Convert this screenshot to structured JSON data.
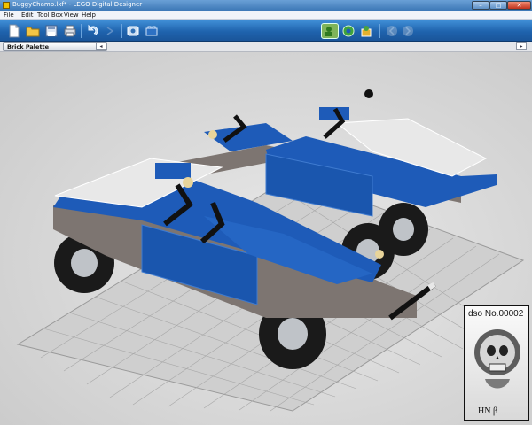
{
  "window": {
    "title": "BuggyChamp.lxf* - LEGO Digital Designer"
  },
  "menu": {
    "items": [
      "File",
      "Edit",
      "Tool Box",
      "View",
      "Help"
    ]
  },
  "toolbar": {
    "left_icons": [
      "new-file-icon",
      "open-folder-icon",
      "save-icon",
      "print-icon",
      "undo-icon",
      "redo-icon",
      "camera-icon",
      "build-mode-icon"
    ],
    "mode_icons": [
      "build-mode-green-icon",
      "view-mode-icon",
      "building-guide-icon"
    ],
    "disabled_icons": [
      "prev-step-icon",
      "next-step-icon"
    ]
  },
  "palette": {
    "label": "Brick Palette",
    "collapse_glyph": "◂"
  },
  "model": {
    "body_color": "#1e5bb8",
    "panel_color": "#e8e8e8",
    "frame_color": "#7d7571",
    "tire_color": "#1a1a1a",
    "floor_grid": "#8f8f8f"
  },
  "stamp": {
    "number_text": "dso No.00002",
    "signature": "HN β"
  }
}
